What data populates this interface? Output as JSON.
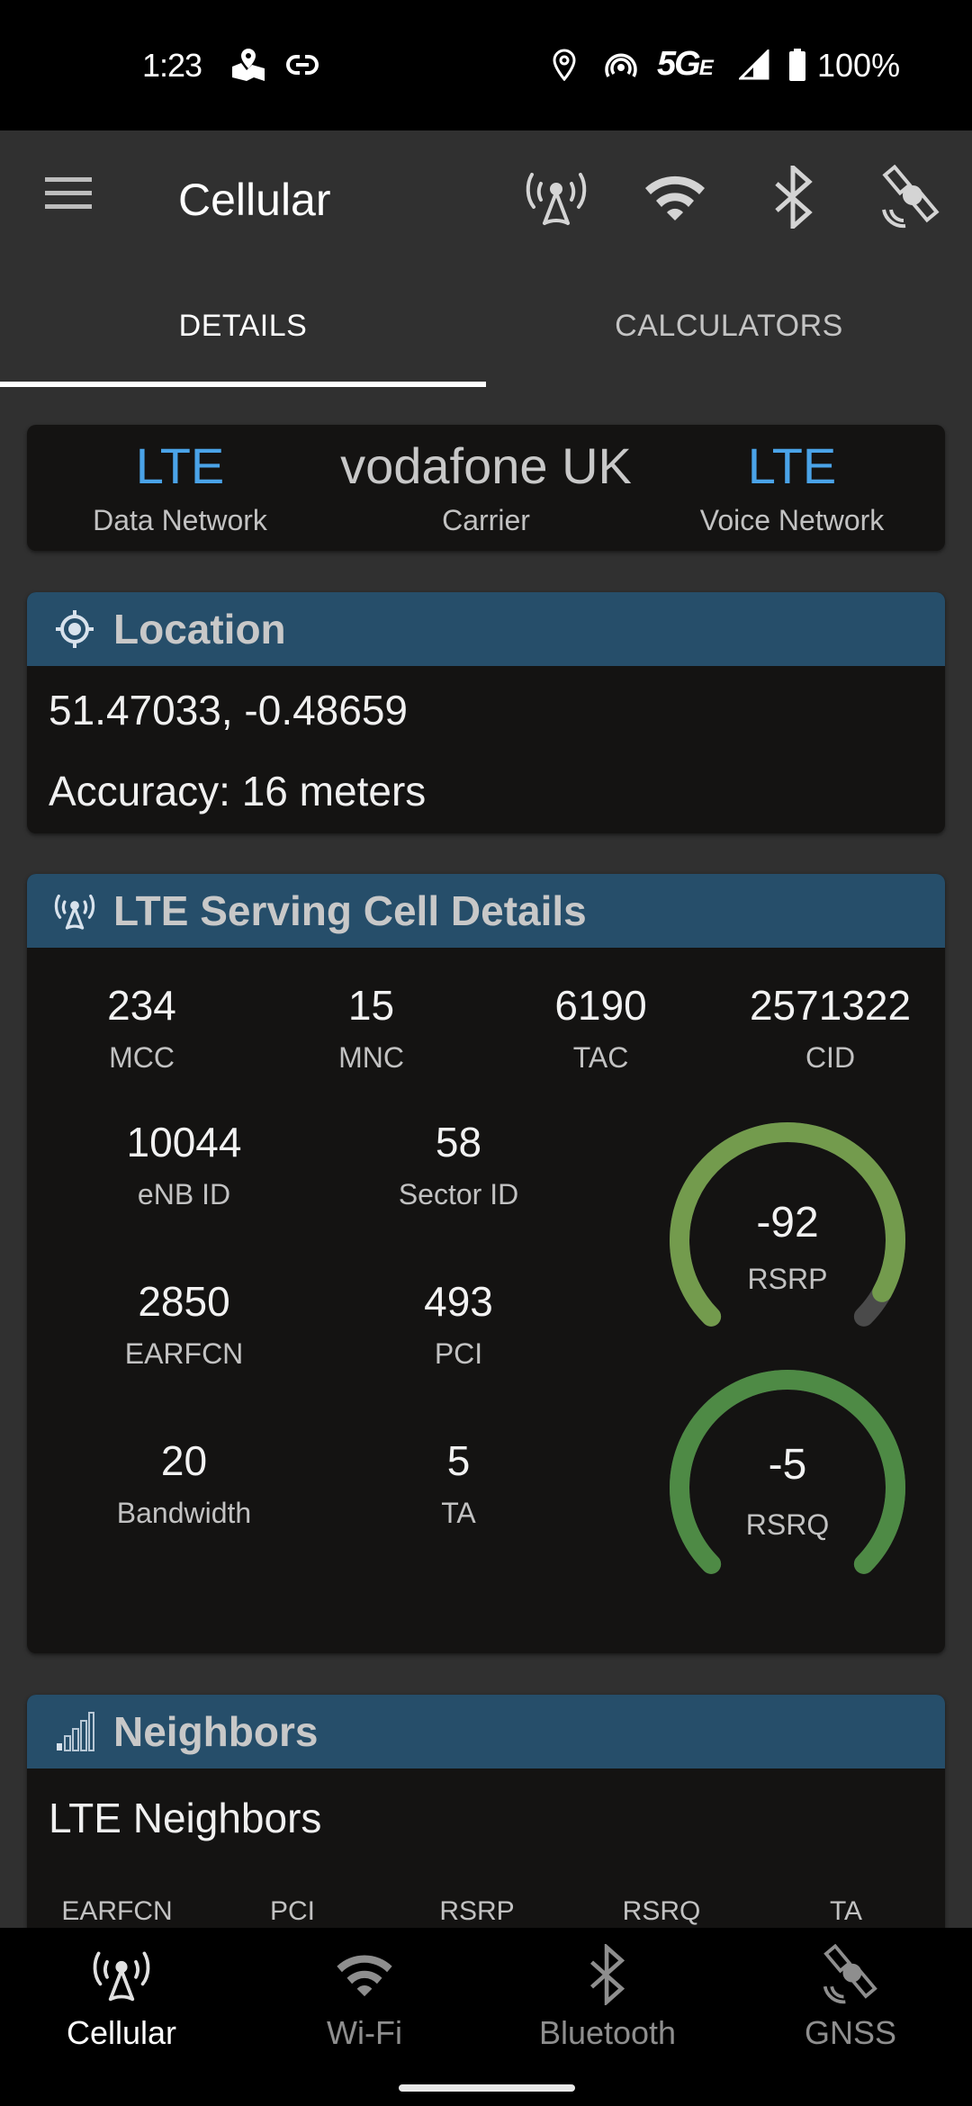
{
  "status_bar": {
    "time": "1:23",
    "network_type": "5G",
    "network_suffix": "E",
    "battery": "100%",
    "icons": [
      "maps-icon",
      "link-icon",
      "location-icon",
      "hotspot-icon",
      "signal-icon",
      "battery-icon"
    ]
  },
  "app_bar": {
    "title": "Cellular",
    "menu_icon": "hamburger-menu-icon",
    "action_icons": [
      "cell-tower-icon",
      "wifi-icon",
      "bluetooth-icon",
      "satellite-icon"
    ]
  },
  "tabs": [
    {
      "label": "DETAILS",
      "active": true
    },
    {
      "label": "CALCULATORS",
      "active": false
    }
  ],
  "summary": {
    "data_network": {
      "value": "LTE",
      "label": "Data Network"
    },
    "carrier": {
      "value": "vodafone UK",
      "label": "Carrier"
    },
    "voice_network": {
      "value": "LTE",
      "label": "Voice Network"
    },
    "accent_color": "#4aa3e8"
  },
  "location": {
    "title": "Location",
    "coordinates": "51.47033, -0.48659",
    "accuracy": "Accuracy: 16 meters"
  },
  "serving_cell": {
    "title": "LTE Serving Cell Details",
    "top_row": [
      {
        "value": "234",
        "label": "MCC"
      },
      {
        "value": "15",
        "label": "MNC"
      },
      {
        "value": "6190",
        "label": "TAC"
      },
      {
        "value": "2571322",
        "label": "CID"
      }
    ],
    "grid": [
      [
        {
          "value": "10044",
          "label": "eNB ID"
        },
        {
          "value": "58",
          "label": "Sector ID"
        }
      ],
      [
        {
          "value": "2850",
          "label": "EARFCN"
        },
        {
          "value": "493",
          "label": "PCI"
        }
      ],
      [
        {
          "value": "20",
          "label": "Bandwidth"
        },
        {
          "value": "5",
          "label": "TA"
        }
      ]
    ],
    "gauges": [
      {
        "label": "RSRP",
        "value": "-92",
        "fill_fraction": 0.94,
        "color": "#739b4d"
      },
      {
        "label": "RSRQ",
        "value": "-5",
        "fill_fraction": 1.0,
        "color": "#4e8a45"
      }
    ]
  },
  "neighbors": {
    "title": "Neighbors",
    "subtitle": "LTE Neighbors",
    "columns": [
      "EARFCN",
      "PCI",
      "RSRP",
      "RSRQ",
      "TA"
    ]
  },
  "bottom_nav": [
    {
      "label": "Cellular",
      "icon": "cell-tower-icon",
      "active": true
    },
    {
      "label": "Wi-Fi",
      "icon": "wifi-icon",
      "active": false
    },
    {
      "label": "Bluetooth",
      "icon": "bluetooth-icon",
      "active": false
    },
    {
      "label": "GNSS",
      "icon": "satellite-icon",
      "active": false
    }
  ],
  "colors": {
    "card_header": "#264e6a",
    "card_body": "#141312",
    "background": "#303030"
  }
}
